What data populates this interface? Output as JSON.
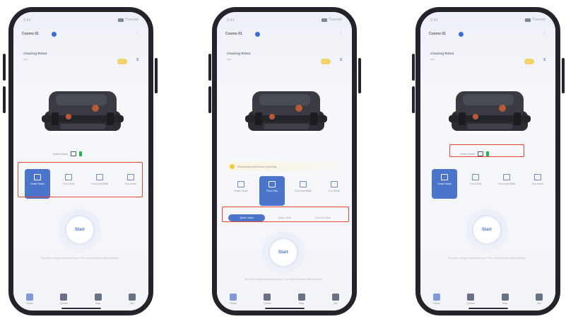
{
  "status": {
    "time": "9:41",
    "carrier": "Tvarnet"
  },
  "header": {
    "device": "Cosmo 01"
  },
  "device": {
    "title": "Cleaning Robot",
    "subtitle": "Idle",
    "battery": "5"
  },
  "pill": {
    "label": "Video Mode"
  },
  "notice": {
    "text": "Recommended Mode Cleaning"
  },
  "modes": [
    {
      "label": "Smart Clean"
    },
    {
      "label": "Floor Only"
    },
    {
      "label": "Floor and Walls"
    },
    {
      "label": "Eco Mode"
    }
  ],
  "segments": [
    {
      "label": "Quick Clean"
    },
    {
      "label": "Deep Clean"
    },
    {
      "label": "Custom Clean"
    }
  ],
  "start": {
    "label": "Start"
  },
  "hint": {
    "text": "Tap Start to begin cleaning the pool. The robot will return after finishing."
  },
  "nav": [
    {
      "label": "Home"
    },
    {
      "label": "Control"
    },
    {
      "label": "Map"
    },
    {
      "label": "Me"
    }
  ],
  "colors": {
    "accent": "#4b74cb",
    "highlight": "#e8462e",
    "frame": "#24222b"
  }
}
